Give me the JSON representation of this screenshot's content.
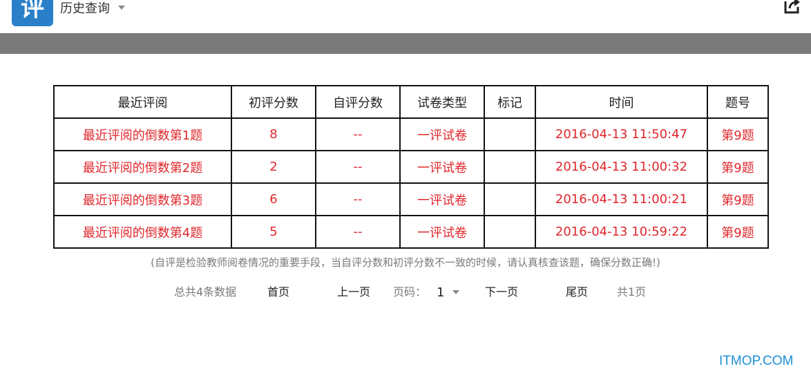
{
  "header": {
    "logo_glyph": "评",
    "title": "历史查询",
    "logo_color": "#2b7fc8",
    "icons": [
      "caret-down-icon",
      "share-icon"
    ]
  },
  "table": {
    "headers": [
      "最近评阅",
      "初评分数",
      "自评分数",
      "试卷类型",
      "标记",
      "时间",
      "题号"
    ],
    "rows": [
      [
        "最近评阅的倒数第1题",
        "8",
        "--",
        "一评试卷",
        "",
        "2016-04-13 11:50:47",
        "第9题"
      ],
      [
        "最近评阅的倒数第2题",
        "2",
        "--",
        "一评试卷",
        "",
        "2016-04-13 11:00:32",
        "第9题"
      ],
      [
        "最近评阅的倒数第3题",
        "6",
        "--",
        "一评试卷",
        "",
        "2016-04-13 11:00:21",
        "第9题"
      ],
      [
        "最近评阅的倒数第4题",
        "5",
        "--",
        "一评试卷",
        "",
        "2016-04-13 10:59:22",
        "第9题"
      ]
    ],
    "value_color": "#e0262b"
  },
  "note": "(自评是检验教师阅卷情况的重要手段，当自评分数和初评分数不一致的时候，请认真核查该题，确保分数正确!)",
  "pagination": {
    "total": "总共4条数据",
    "first": "首页",
    "prev": "上一页",
    "page_label": "页码：",
    "page_value": "1",
    "next": "下一页",
    "last": "尾页",
    "page_count": "共1页"
  },
  "watermark": "ITMOP.COM"
}
